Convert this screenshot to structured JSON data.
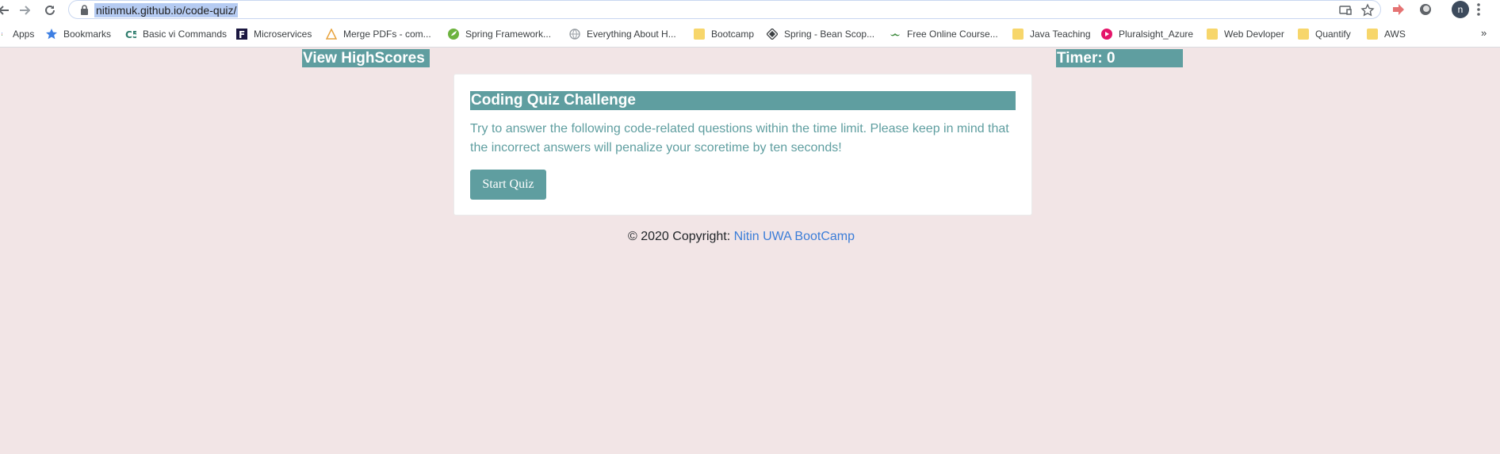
{
  "browser": {
    "url": "nitinmuk.github.io/code-quiz/",
    "avatar_initial": "n",
    "icons": {
      "back": "arrow-left-icon",
      "forward": "arrow-right-icon",
      "reload": "reload-icon",
      "lock": "lock-icon",
      "cast": "cast-icon",
      "star": "star-icon",
      "menu": "kebab-menu-icon"
    }
  },
  "bookmarks": [
    {
      "label": "Apps",
      "icon": "apps-grid-icon"
    },
    {
      "label": "Bookmarks",
      "icon": "star-icon"
    },
    {
      "label": "Basic vi Commands",
      "icon": "cs-logo-icon"
    },
    {
      "label": "Microservices",
      "icon": "f-logo-icon"
    },
    {
      "label": "Merge PDFs - com...",
      "icon": "warning-triangle-icon"
    },
    {
      "label": "Spring Framework...",
      "icon": "spring-leaf-icon"
    },
    {
      "label": "Everything About H...",
      "icon": "globe-icon"
    },
    {
      "label": "Bootcamp",
      "icon": "folder-icon"
    },
    {
      "label": "Spring - Bean Scop...",
      "icon": "diamond-icon"
    },
    {
      "label": "Free Online Course...",
      "icon": "mustache-icon"
    },
    {
      "label": "Java Teaching",
      "icon": "folder-icon"
    },
    {
      "label": "Pluralsight_Azure",
      "icon": "pluralsight-icon"
    },
    {
      "label": "Web Devloper",
      "icon": "folder-icon"
    },
    {
      "label": "Quantify",
      "icon": "folder-icon"
    },
    {
      "label": "AWS",
      "icon": "folder-icon"
    }
  ],
  "page": {
    "highscores_link": "View HighScores",
    "timer_label": "Timer: 0",
    "card_title": "Coding Quiz Challenge",
    "card_text": "Try to answer the following code-related questions within the time limit. Please keep in mind that the incorrect answers will penalize your scoretime by ten seconds!",
    "start_button": "Start Quiz",
    "footer_prefix": "© 2020 Copyright:",
    "footer_link": "Nitin UWA BootCamp"
  },
  "colors": {
    "page_bg": "#f2e5e6",
    "accent": "#5f9ea0",
    "link": "#3b7dd8"
  }
}
